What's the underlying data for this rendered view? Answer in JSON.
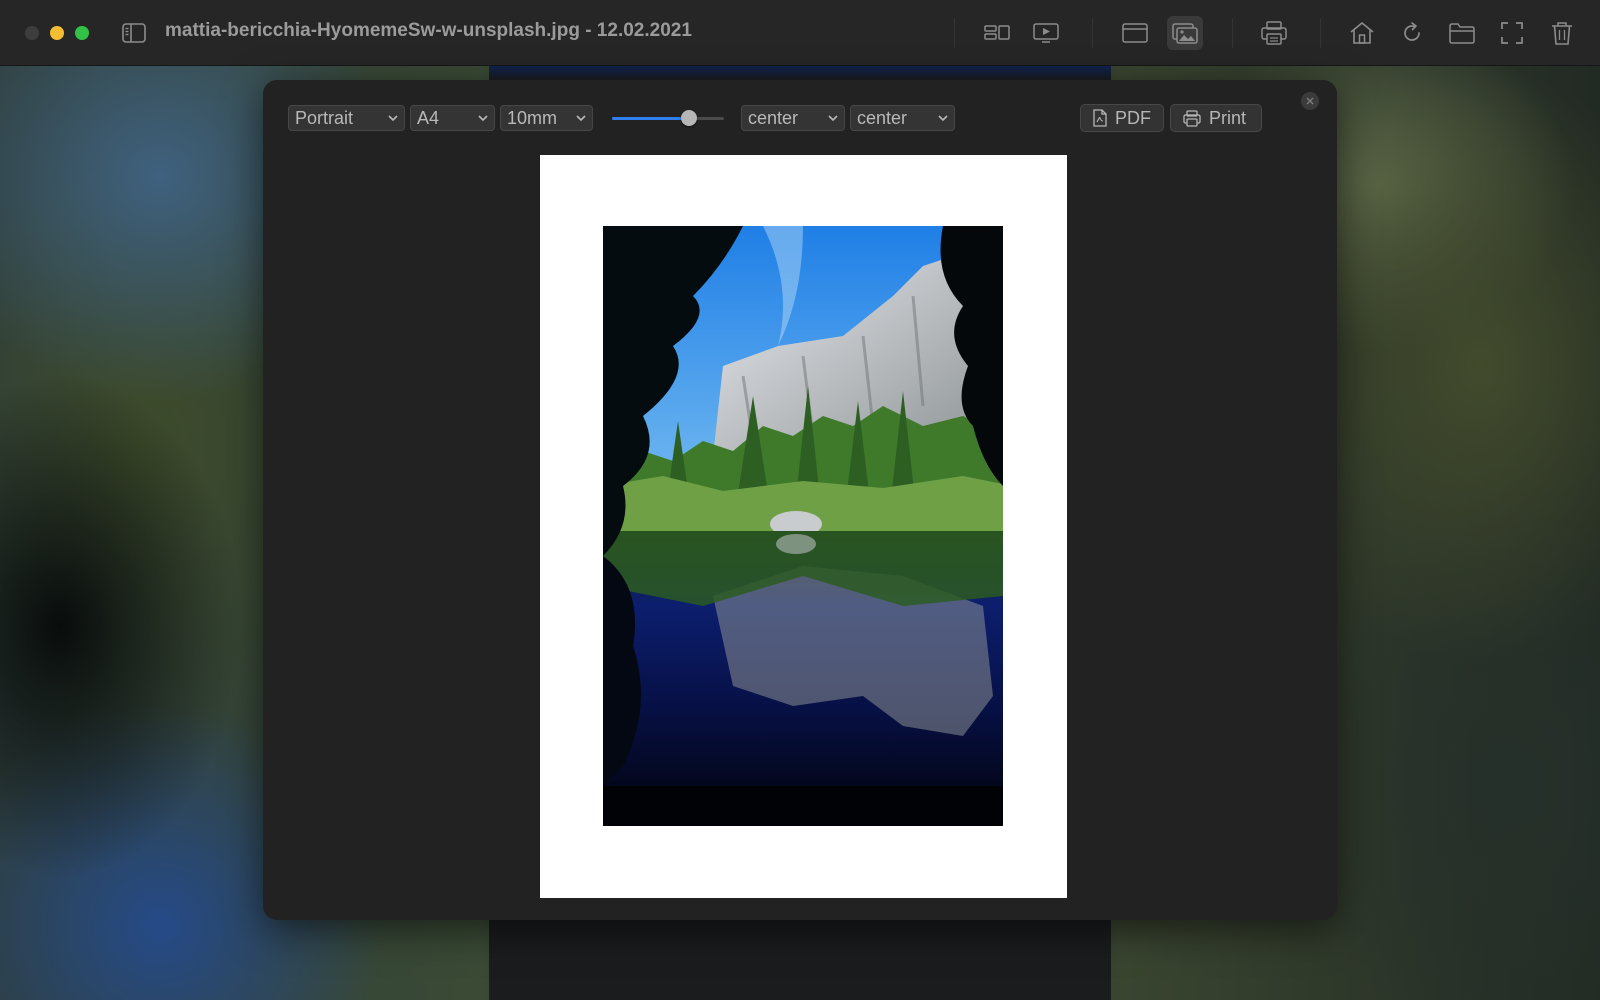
{
  "window": {
    "title": "mattia-bericchia-HyomemeSw-w-unsplash.jpg - 12.02.2021"
  },
  "toolbar": {
    "buttons": [
      {
        "name": "grid-view-icon",
        "active": false
      },
      {
        "name": "slideshow-icon",
        "active": false
      },
      {
        "name": "window-icon",
        "active": false
      },
      {
        "name": "image-library-icon",
        "active": true
      },
      {
        "name": "printer-icon",
        "active": false
      },
      {
        "name": "home-icon",
        "active": false
      },
      {
        "name": "refresh-icon",
        "active": false
      },
      {
        "name": "folder-icon",
        "active": false
      },
      {
        "name": "fullscreen-icon",
        "active": false
      },
      {
        "name": "trash-icon",
        "active": false
      }
    ]
  },
  "print_dialog": {
    "orientation": "Portrait",
    "paper_size": "A4",
    "margin": "10mm",
    "scale_level": 0.72,
    "horizontal_align": "center",
    "vertical_align": "center",
    "pdf_label": "PDF",
    "print_label": "Print"
  },
  "colors": {
    "accent": "#2f7ff0",
    "close_light": "#3d3d3d",
    "minimize_light": "#f5bd31",
    "maximize_light": "#31c146"
  }
}
